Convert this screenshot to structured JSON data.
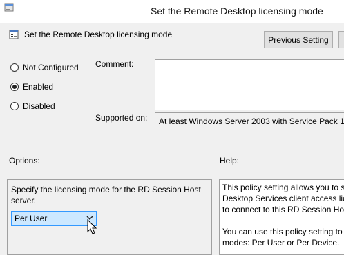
{
  "window": {
    "title": "Set the Remote Desktop licensing mode",
    "policy_name": "Set the Remote Desktop licensing mode"
  },
  "toolbar": {
    "previous_setting_label": "Previous Setting"
  },
  "state": {
    "options": [
      {
        "label": "Not Configured",
        "checked": false
      },
      {
        "label": "Enabled",
        "checked": true
      },
      {
        "label": "Disabled",
        "checked": false
      }
    ]
  },
  "comment": {
    "label": "Comment:",
    "value": ""
  },
  "supported_on": {
    "label": "Supported on:",
    "value": "At least Windows Server 2003 with Service Pack 1"
  },
  "options_section": {
    "label": "Options:",
    "description": "Specify the licensing mode for the RD Session Host server.",
    "licensing_mode_selected": "Per User"
  },
  "help_section": {
    "label": "Help:",
    "lines": [
      "This policy setting allows you to s",
      "Desktop Services client access lice",
      "to connect to this RD Session Hos"
    ],
    "lines2": [
      "You can use this policy setting to",
      "modes: Per User or Per Device."
    ]
  }
}
